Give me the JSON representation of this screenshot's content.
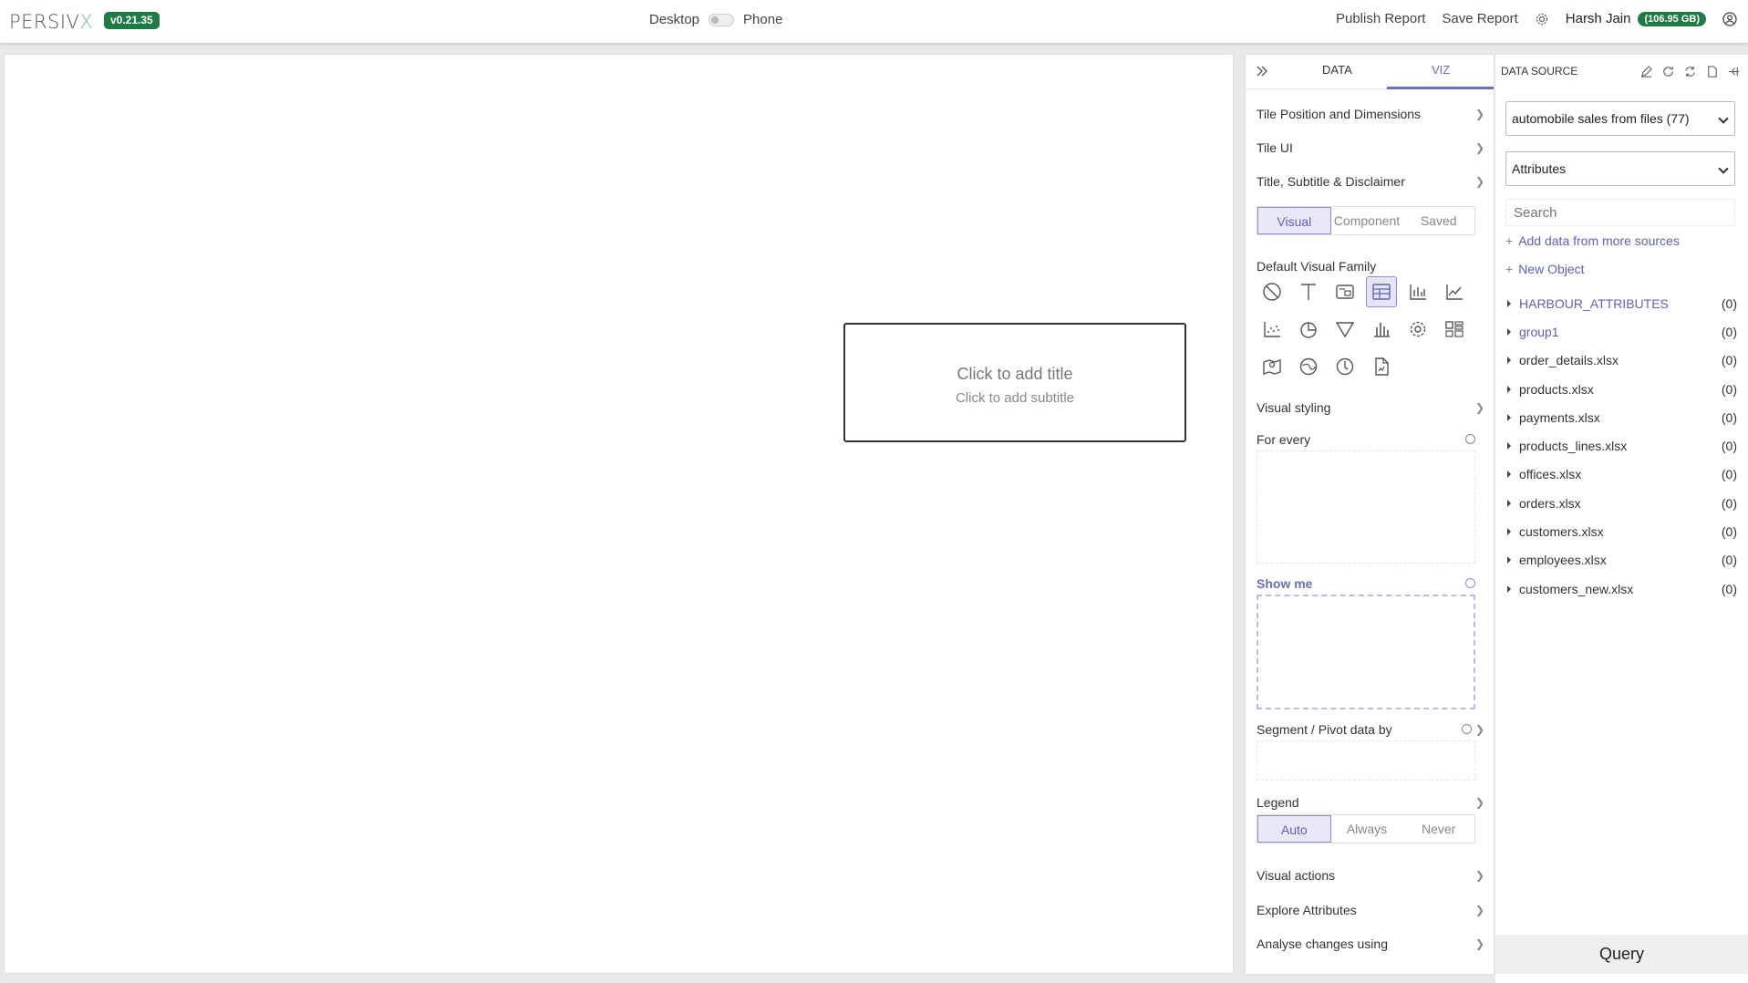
{
  "header": {
    "logo_main": "PERSIV",
    "logo_x": "X",
    "version": "v0.21.35",
    "device_desktop": "Desktop",
    "device_phone": "Phone",
    "publish": "Publish Report",
    "save": "Save Report",
    "user": "Harsh Jain",
    "storage": "(106.95 GB)"
  },
  "tile": {
    "title": "Click to add title",
    "subtitle": "Click to add subtitle"
  },
  "viz_panel": {
    "tabs": {
      "data": "DATA",
      "viz": "VIZ"
    },
    "sections": {
      "tile_position": "Tile Position and Dimensions",
      "tile_ui": "Tile UI",
      "title_subtitle": "Title, Subtitle & Disclaimer",
      "default_family": "Default Visual Family",
      "visual_styling": "Visual styling",
      "for_every": "For every",
      "show_me": "Show me",
      "segment": "Segment / Pivot data by",
      "legend": "Legend",
      "visual_actions": "Visual actions",
      "explore": "Explore Attributes",
      "analyse": "Analyse changes using"
    },
    "mode_tabs": [
      "Visual",
      "Component",
      "Saved"
    ],
    "legend_options": [
      "Auto",
      "Always",
      "Never"
    ],
    "visual_icons": [
      "none-icon",
      "text-icon",
      "kpi-card-icon",
      "table-icon",
      "bar-chart-icon",
      "line-chart-icon",
      "scatter-chart-icon",
      "pie-chart-icon",
      "funnel-icon",
      "histogram-icon",
      "settings-gear-icon",
      "layout-grid-icon",
      "map-icon",
      "globe-icon",
      "clock-icon",
      "document-icon"
    ]
  },
  "data_source": {
    "title": "DATA SOURCE",
    "selected_source": "automobile sales from files (77)",
    "selected_view": "Attributes",
    "search_placeholder": "Search",
    "add_more": "Add data from more sources",
    "new_object": "New Object",
    "items": [
      {
        "label": "HARBOUR_ATTRIBUTES",
        "count": "(0)",
        "blue": true
      },
      {
        "label": "group1",
        "count": "(0)",
        "blue": true
      },
      {
        "label": "order_details.xlsx",
        "count": "(0)",
        "blue": false
      },
      {
        "label": "products.xlsx",
        "count": "(0)",
        "blue": false
      },
      {
        "label": "payments.xlsx",
        "count": "(0)",
        "blue": false
      },
      {
        "label": "products_lines.xlsx",
        "count": "(0)",
        "blue": false
      },
      {
        "label": "offices.xlsx",
        "count": "(0)",
        "blue": false
      },
      {
        "label": "orders.xlsx",
        "count": "(0)",
        "blue": false
      },
      {
        "label": "customers.xlsx",
        "count": "(0)",
        "blue": false
      },
      {
        "label": "employees.xlsx",
        "count": "(0)",
        "blue": false
      },
      {
        "label": "customers_new.xlsx",
        "count": "(0)",
        "blue": false
      }
    ],
    "query": "Query"
  }
}
